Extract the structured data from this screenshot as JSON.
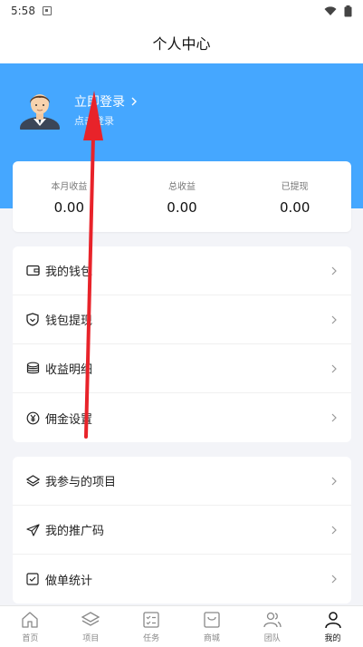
{
  "status_bar": {
    "time": "5:58"
  },
  "header": {
    "title": "个人中心"
  },
  "hero": {
    "login_title": "立即登录",
    "login_sub": "点击登录"
  },
  "stats": [
    {
      "label": "本月收益",
      "value": "0.00"
    },
    {
      "label": "总收益",
      "value": "0.00"
    },
    {
      "label": "已提现",
      "value": "0.00"
    }
  ],
  "menu_group_1": [
    {
      "label": "我的钱包",
      "icon": "wallet-icon"
    },
    {
      "label": "钱包提现",
      "icon": "shield-icon"
    },
    {
      "label": "收益明细",
      "icon": "database-icon"
    },
    {
      "label": "佣金设置",
      "icon": "yen-icon"
    }
  ],
  "menu_group_2": [
    {
      "label": "我参与的项目",
      "icon": "layers-icon"
    },
    {
      "label": "我的推广码",
      "icon": "send-icon"
    },
    {
      "label": "做单统计",
      "icon": "checkbox-icon"
    }
  ],
  "tabs": [
    {
      "label": "首页",
      "icon": "home-icon"
    },
    {
      "label": "项目",
      "icon": "layers-icon"
    },
    {
      "label": "任务",
      "icon": "task-list-icon"
    },
    {
      "label": "商城",
      "icon": "store-icon"
    },
    {
      "label": "团队",
      "icon": "team-icon"
    },
    {
      "label": "我的",
      "icon": "user-icon"
    }
  ],
  "colors": {
    "hero_bg": "#45a7ff",
    "page_bg": "#f3f4f8",
    "annotation_red": "#e8232a"
  }
}
